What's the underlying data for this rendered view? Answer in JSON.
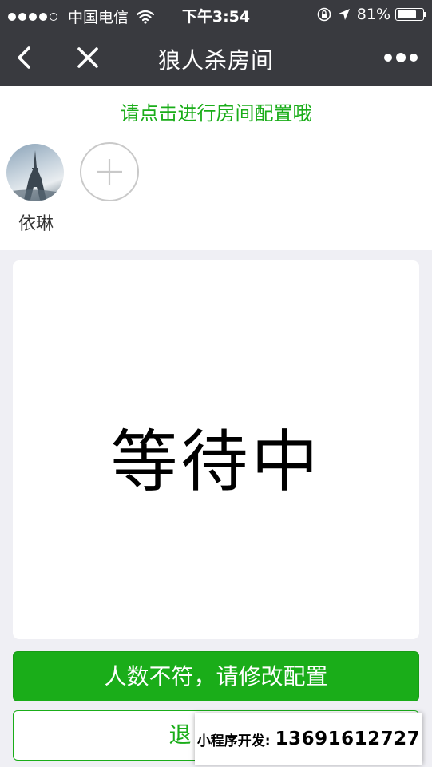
{
  "status_bar": {
    "carrier": "中国电信",
    "time": "下午3:54",
    "battery_text": "81%",
    "battery_level": 0.81,
    "signal_bars_filled": 4,
    "signal_bars_total": 5,
    "icons": [
      "signal-dots-icon",
      "wifi-icon",
      "orientation-lock-icon",
      "location-arrow-icon",
      "battery-icon"
    ]
  },
  "nav": {
    "title": "狼人杀房间",
    "icons": [
      "back-chevron-icon",
      "close-icon",
      "more-dots-icon"
    ]
  },
  "room": {
    "hint": "请点击进行房间配置哦",
    "players": [
      {
        "name": "依琳",
        "avatar": "eiffel-tower-photo"
      }
    ],
    "add_seat_icon": "plus-icon"
  },
  "status_card": {
    "text": "等待中"
  },
  "actions": {
    "primary_label": "人数不符，请修改配置",
    "secondary_label": "退"
  },
  "dev_banner": {
    "label": "小程序开发:",
    "phone": "13691612727"
  },
  "colors": {
    "accent": "#1aad19",
    "nav_background": "#393a3f",
    "page_background": "#efeff4"
  }
}
